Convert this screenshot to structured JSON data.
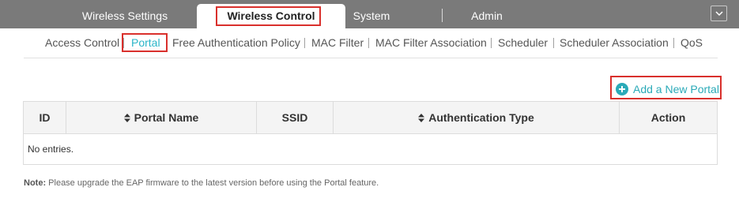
{
  "top_tabs": [
    {
      "label": "Wireless Settings",
      "active": false
    },
    {
      "label": "Wireless Control",
      "active": true
    },
    {
      "label": "System",
      "active": false
    },
    {
      "label": "Admin",
      "active": false
    }
  ],
  "menu_icon": "chevron-down-icon",
  "subnav": [
    {
      "label": "Access Control",
      "active": false
    },
    {
      "label": "Portal",
      "active": true
    },
    {
      "label": "Free Authentication Policy",
      "active": false
    },
    {
      "label": "MAC Filter",
      "active": false
    },
    {
      "label": "MAC Filter Association",
      "active": false
    },
    {
      "label": "Scheduler",
      "active": false
    },
    {
      "label": "Scheduler Association",
      "active": false
    },
    {
      "label": "QoS",
      "active": false
    }
  ],
  "add_portal": {
    "label": "Add a New Portal",
    "icon": "plus-circle-icon"
  },
  "table": {
    "columns": [
      {
        "label": "ID",
        "sortable": false
      },
      {
        "label": "Portal Name",
        "sortable": true
      },
      {
        "label": "SSID",
        "sortable": false
      },
      {
        "label": "Authentication Type",
        "sortable": true
      },
      {
        "label": "Action",
        "sortable": false
      }
    ],
    "empty_text": "No entries."
  },
  "note": {
    "prefix": "Note:",
    "text": " Please upgrade the EAP firmware to the latest version before using the Portal feature."
  },
  "colors": {
    "topbar": "#7a7a7a",
    "accent": "#2aaab8",
    "highlight_box": "#d9302c"
  }
}
